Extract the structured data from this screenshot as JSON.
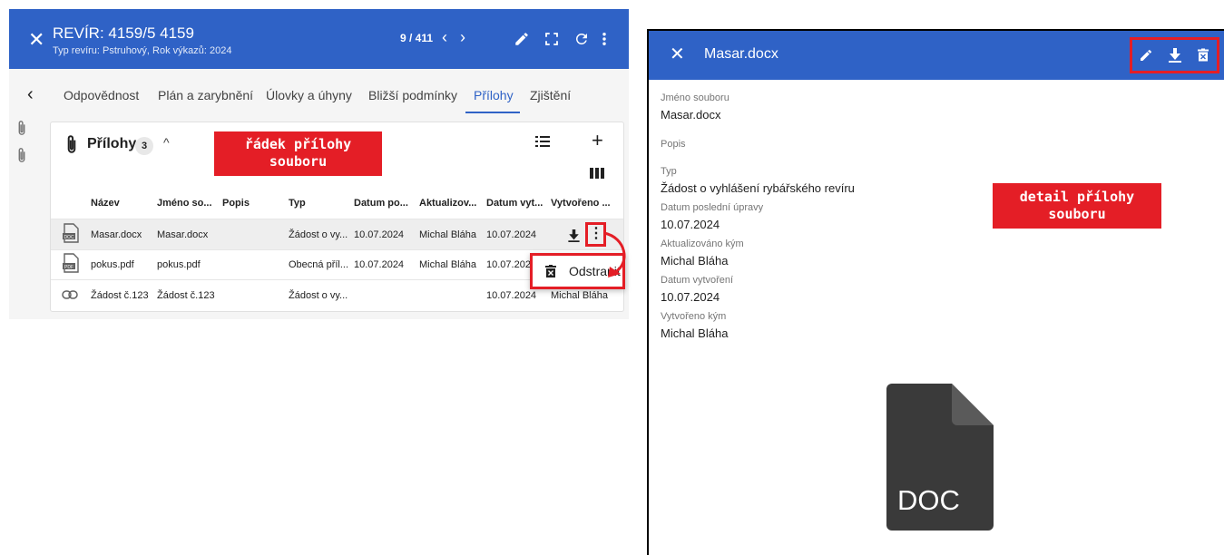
{
  "left_panel": {
    "header": {
      "close_icon": "close-icon",
      "title": "REVÍR: 4159/5 4159",
      "subtitle": "Typ revíru: Pstruhový, Rok výkazů: 2024",
      "counter": "9 / 411",
      "prev_icon": "chevron-left-icon",
      "next_icon": "chevron-right-icon",
      "actions": [
        "edit-icon",
        "fullscreen-icon",
        "refresh-icon",
        "more-vert-icon"
      ],
      "color": "#2f62c6"
    },
    "tabs": {
      "items": [
        "Odpovědnost",
        "Plán a zarybnění",
        "Úlovky a úhyny",
        "Bližší podmínky",
        "Přílohy",
        "Zjištění"
      ],
      "active": "Přílohy"
    },
    "card": {
      "title": "Přílohy",
      "count": "3",
      "columns": [
        "Název",
        "Jméno so...",
        "Popis",
        "Typ",
        "Datum po...",
        "Aktualizov...",
        "Datum vyt...",
        "Vytvořeno ..."
      ],
      "rows": [
        {
          "icon": "doc-file-icon",
          "name": "Masar.docx",
          "file": "Masar.docx",
          "desc": "",
          "type": "Žádost o vy...",
          "modified": "10.07.2024",
          "updated_by": "Michal Bláha",
          "created": "10.07.2024",
          "created_by": ""
        },
        {
          "icon": "pdf-file-icon",
          "name": "pokus.pdf",
          "file": "pokus.pdf",
          "desc": "",
          "type": "Obecná příl...",
          "modified": "10.07.2024",
          "updated_by": "Michal Bláha",
          "created": "10.07.202",
          "created_by": ""
        },
        {
          "icon": "link-icon",
          "name": "Žádost č.123",
          "file": "Žádost č.123",
          "desc": "",
          "type": "Žádost o vy...",
          "modified": "",
          "updated_by": "",
          "created": "10.07.2024",
          "created_by": "Michal Bláha"
        }
      ]
    },
    "context_menu": {
      "label": "Odstranit",
      "icon": "delete-icon"
    },
    "callout": [
      "řádek přílohy",
      "souboru"
    ]
  },
  "right_panel": {
    "header": {
      "title": "Masar.docx",
      "actions": [
        "edit-icon",
        "download-icon",
        "delete-icon"
      ]
    },
    "fields": [
      {
        "label": "Jméno souboru",
        "value": "Masar.docx"
      },
      {
        "label": "Popis",
        "value": ""
      },
      {
        "label": "Typ",
        "value": "Žádost o vyhlášení rybářského revíru"
      },
      {
        "label": "Datum poslední úpravy",
        "value": "10.07.2024"
      },
      {
        "label": "Aktualizováno kým",
        "value": "Michal Bláha"
      },
      {
        "label": "Datum vytvoření",
        "value": "10.07.2024"
      },
      {
        "label": "Vytvořeno kým",
        "value": "Michal Bláha"
      }
    ],
    "preview_label": "DOC",
    "callout": [
      "detail přílohy",
      "souboru"
    ]
  },
  "colors": {
    "primary": "#2f62c6",
    "annotation": "#e41e26"
  }
}
